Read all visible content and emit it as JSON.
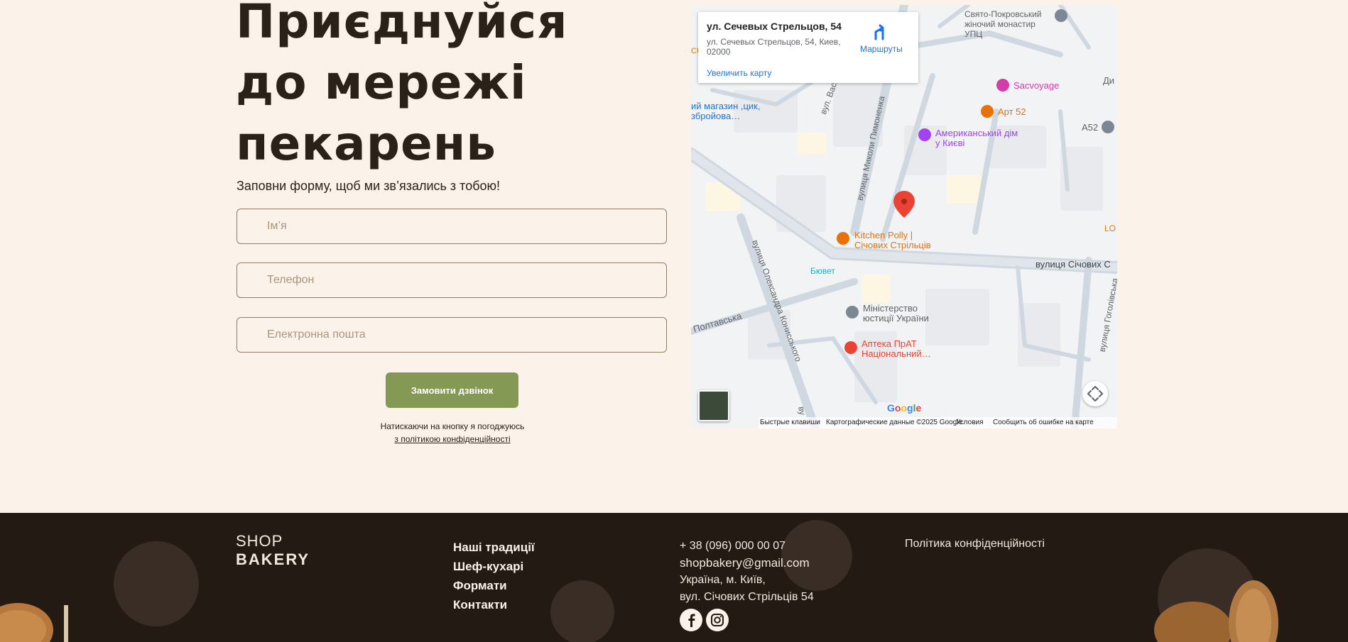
{
  "form": {
    "title": "Приєднуйся до мережі пекарень",
    "subtitle": "Заповни форму, щоб ми зв’язались з тобою!",
    "name_placeholder": "Ім’я",
    "phone_placeholder": "Телефон",
    "email_placeholder": "Електронна пошта",
    "submit_label": "Замовити дзвінок",
    "consent_text": "Натискаючи на кнопку я погоджуюсь",
    "consent_link": "з політикою конфіденційності"
  },
  "map": {
    "card_title": "ул. Сечевых Стрельцов, 54",
    "card_address": "ул. Сечевых Стрельцов, 54, Киев, 02000",
    "routes_label": "Маршруты",
    "enlarge_label": "Увеличить карту",
    "streets": {
      "vasylia": "вул. Василя Д",
      "pymonenka": "вулиця Миколи Пимоненка",
      "konyskoho": "вулиця Олександра Конисського",
      "sichovykh": "вулиця Січових С",
      "poltavska": "Полтавська",
      "hoholivska": "вулиця Гоголівська",
      "vu": "ву"
    },
    "pois": {
      "monastery": "Свято-Покровський жіночий монастир УПЦ",
      "sacvoyage": "Sacvoyage",
      "art52": "Арт 52",
      "american_house": "Американський дім у Києві",
      "a52": "A52",
      "di": "Ди",
      "shop": "ий магазин ,цик, збройова…",
      "kitchen": "Kitchen Polly | Січових Стрільців",
      "buvet": "Бювет",
      "ministry": "Міністерство юстиції України",
      "pharmacy": "Аптека ПрАТ Національний…",
      "lo": "LO",
      "cu": "CU"
    },
    "google": "Google",
    "footer": {
      "shortcuts": "Быстрые клавиши",
      "data": "Картографические данные ©2025 Google",
      "terms": "Условия",
      "report": "Сообщить об ошибке на карте"
    }
  },
  "footer": {
    "logo_top": "SHOP",
    "logo_bottom": "BAKERY",
    "nav": [
      "Наші традиції",
      "Шеф-кухарі",
      "Формати",
      "Контакти"
    ],
    "phone": "+ 38 (096) 000 00 07",
    "email": "shopbakery@gmail.com",
    "address_line1": "Україна, м. Київ,",
    "address_line2": "вул. Січових Стрільців 54",
    "policy": "Політика конфіденційності",
    "social": [
      "facebook-icon",
      "instagram-icon"
    ]
  },
  "colors": {
    "background": "#fbf3e9",
    "text": "#2a2118",
    "button": "#849954",
    "footer": "#231a14",
    "pin": "#ea4335"
  }
}
